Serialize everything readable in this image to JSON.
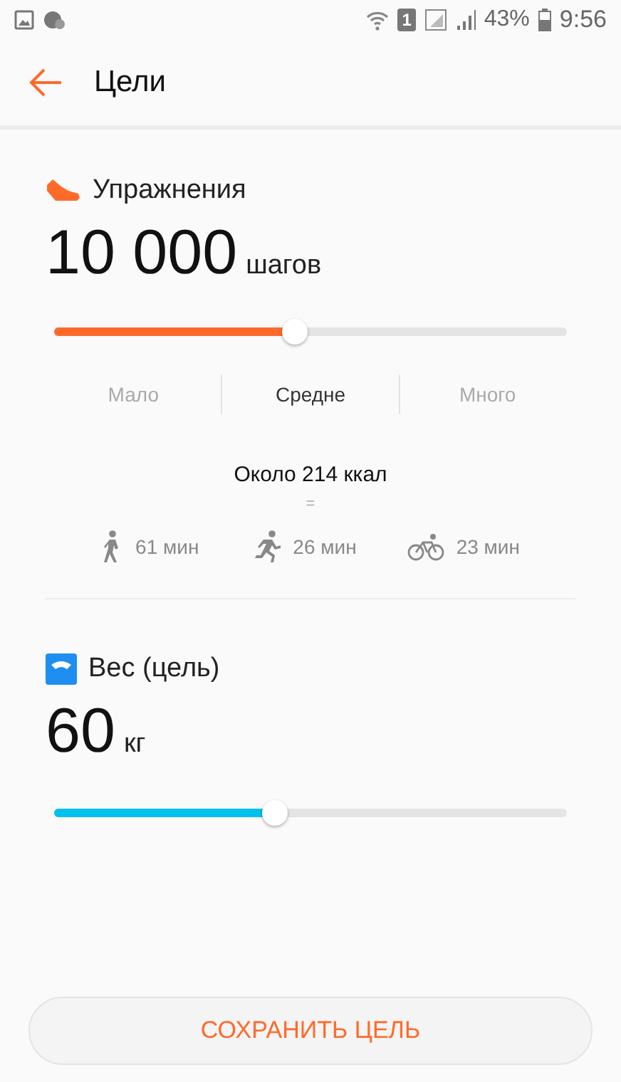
{
  "status_bar": {
    "battery": "43%",
    "time": "9:56",
    "sim": "1"
  },
  "header": {
    "title": "Цели"
  },
  "exercise": {
    "title": "Упражнения",
    "value": "10 000",
    "unit": "шагов",
    "color": "#ff6a2b",
    "level": 0.47,
    "options": [
      {
        "label": "Мало",
        "selected": false
      },
      {
        "label": "Средне",
        "selected": true
      },
      {
        "label": "Много",
        "selected": false
      }
    ],
    "calories": "Около 214 ккал",
    "equals": "=",
    "activities": [
      {
        "kind": "walk",
        "time": "61 мин"
      },
      {
        "kind": "run",
        "time": "26 мин"
      },
      {
        "kind": "bike",
        "time": "23 мин"
      }
    ]
  },
  "weight": {
    "title": "Вес (цель)",
    "value": "60",
    "unit": "кг",
    "color": "#00c0ee",
    "level": 0.43
  },
  "save_button": "СОХРАНИТЬ ЦЕЛЬ"
}
